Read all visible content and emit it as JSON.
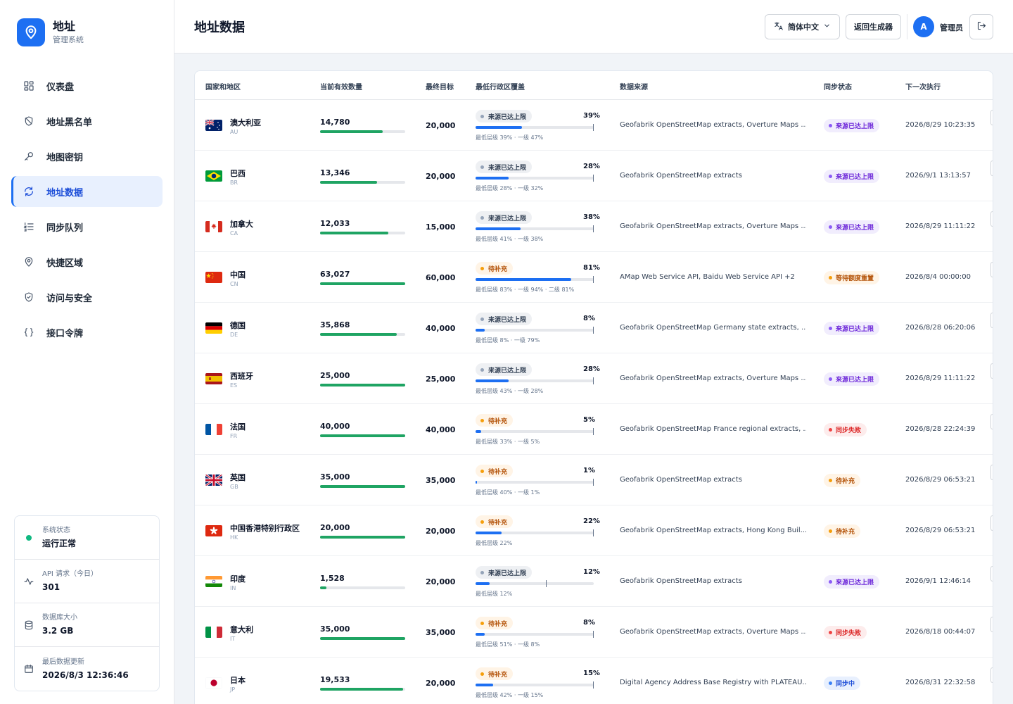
{
  "brand": {
    "title": "地址",
    "subtitle": "管理系统"
  },
  "nav": [
    {
      "id": "dashboard",
      "label": "仪表盘",
      "icon": "dashboard-grid-icon"
    },
    {
      "id": "blacklist",
      "label": "地址黑名单",
      "icon": "shield-off-icon"
    },
    {
      "id": "map-key",
      "label": "地图密钥",
      "icon": "key-icon"
    },
    {
      "id": "address-data",
      "label": "地址数据",
      "icon": "refresh-icon",
      "active": true
    },
    {
      "id": "sync-queue",
      "label": "同步队列",
      "icon": "list-order-icon"
    },
    {
      "id": "quick-region",
      "label": "快捷区域",
      "icon": "map-pin-icon"
    },
    {
      "id": "access-security",
      "label": "访问与安全",
      "icon": "shield-check-icon"
    },
    {
      "id": "api-token",
      "label": "接口令牌",
      "icon": "braces-icon"
    }
  ],
  "status": {
    "system": {
      "label": "系统状态",
      "value": "运行正常"
    },
    "api": {
      "label": "API 请求（今日）",
      "value": "301"
    },
    "db": {
      "label": "数据库大小",
      "value": "3.2 GB"
    },
    "updated": {
      "label": "最后数据更新",
      "value": "2026/8/3 12:36:46"
    }
  },
  "header": {
    "title": "地址数据",
    "language": "简体中文",
    "back": "返回生成器",
    "avatar": "A",
    "user": "管理员"
  },
  "table": {
    "columns": {
      "country": "国家和地区",
      "count": "当前有效数量",
      "target": "最终目标",
      "coverage": "最低行政区覆盖",
      "source": "数据来源",
      "sync": "同步状态",
      "next": "下一次执行"
    },
    "rows": [
      {
        "name": "澳大利亚",
        "code": "AU",
        "flag": "au",
        "count": "14,780",
        "count_ratio": 0.739,
        "target": "20,000",
        "cov_status": "来源已达上限",
        "cov_kind": "gray",
        "cov_pct": "39%",
        "cov_value": 0.39,
        "cov_mark": 1.0,
        "cov_detail": "最低层级 39% · 一级 47%",
        "source": "Geofabrik OpenStreetMap extracts, Overture Maps ...",
        "sync": "来源已达上限",
        "sync_kind": "purple",
        "next": "2026/8/29 10:23:35"
      },
      {
        "name": "巴西",
        "code": "BR",
        "flag": "br",
        "count": "13,346",
        "count_ratio": 0.667,
        "target": "20,000",
        "cov_status": "来源已达上限",
        "cov_kind": "gray",
        "cov_pct": "28%",
        "cov_value": 0.28,
        "cov_mark": 1.0,
        "cov_detail": "最低层级 28% · 一级 32%",
        "source": "Geofabrik OpenStreetMap extracts",
        "sync": "来源已达上限",
        "sync_kind": "purple",
        "next": "2026/9/1 13:13:57"
      },
      {
        "name": "加拿大",
        "code": "CA",
        "flag": "ca",
        "count": "12,033",
        "count_ratio": 0.802,
        "target": "15,000",
        "cov_status": "来源已达上限",
        "cov_kind": "gray",
        "cov_pct": "38%",
        "cov_value": 0.38,
        "cov_mark": 1.0,
        "cov_detail": "最低层级 41% · 一级 38%",
        "source": "Geofabrik OpenStreetMap extracts, Overture Maps ...",
        "sync": "来源已达上限",
        "sync_kind": "purple",
        "next": "2026/8/29 11:11:22"
      },
      {
        "name": "中国",
        "code": "CN",
        "flag": "cn",
        "count": "63,027",
        "count_ratio": 1.0,
        "target": "60,000",
        "cov_status": "待补充",
        "cov_kind": "orange",
        "cov_pct": "81%",
        "cov_value": 0.81,
        "cov_mark": 1.0,
        "cov_detail": "最低层级 83% · 一级 94% · 二级 81%",
        "source": "AMap Web Service API, Baidu Web Service API +2",
        "sync": "等待额度重置",
        "sync_kind": "orange",
        "next": "2026/8/4 00:00:00"
      },
      {
        "name": "德国",
        "code": "DE",
        "flag": "de",
        "count": "35,868",
        "count_ratio": 0.897,
        "target": "40,000",
        "cov_status": "来源已达上限",
        "cov_kind": "gray",
        "cov_pct": "8%",
        "cov_value": 0.08,
        "cov_mark": 1.0,
        "cov_detail": "最低层级 8% · 一级 79%",
        "source": "Geofabrik OpenStreetMap Germany state extracts, ...",
        "sync": "来源已达上限",
        "sync_kind": "purple",
        "next": "2026/8/28 06:20:06"
      },
      {
        "name": "西班牙",
        "code": "ES",
        "flag": "es",
        "count": "25,000",
        "count_ratio": 1.0,
        "target": "25,000",
        "cov_status": "来源已达上限",
        "cov_kind": "gray",
        "cov_pct": "28%",
        "cov_value": 0.28,
        "cov_mark": 1.0,
        "cov_detail": "最低层级 43% · 一级 28%",
        "source": "Geofabrik OpenStreetMap extracts, Overture Maps ...",
        "sync": "来源已达上限",
        "sync_kind": "purple",
        "next": "2026/8/29 11:11:22"
      },
      {
        "name": "法国",
        "code": "FR",
        "flag": "fr",
        "count": "40,000",
        "count_ratio": 1.0,
        "target": "40,000",
        "cov_status": "待补充",
        "cov_kind": "orange",
        "cov_pct": "5%",
        "cov_value": 0.05,
        "cov_mark": 1.0,
        "cov_detail": "最低层级 33% · 一级 5%",
        "source": "Geofabrik OpenStreetMap France regional extracts, ...",
        "sync": "同步失败",
        "sync_kind": "red",
        "next": "2026/8/28 22:24:39"
      },
      {
        "name": "英国",
        "code": "GB",
        "flag": "gb",
        "count": "35,000",
        "count_ratio": 1.0,
        "target": "35,000",
        "cov_status": "待补充",
        "cov_kind": "orange",
        "cov_pct": "1%",
        "cov_value": 0.01,
        "cov_mark": 1.0,
        "cov_detail": "最低层级 40% · 一级 1%",
        "source": "Geofabrik OpenStreetMap extracts",
        "sync": "待补充",
        "sync_kind": "orange",
        "next": "2026/8/29 06:53:21"
      },
      {
        "name": "中国香港特别行政区",
        "code": "HK",
        "flag": "hk",
        "count": "20,000",
        "count_ratio": 1.0,
        "target": "20,000",
        "cov_status": "待补充",
        "cov_kind": "orange",
        "cov_pct": "22%",
        "cov_value": 0.22,
        "cov_mark": 1.0,
        "cov_detail": "最低层级 22%",
        "source": "Geofabrik OpenStreetMap extracts, Hong Kong Buil...",
        "sync": "待补充",
        "sync_kind": "orange",
        "next": "2026/8/29 06:53:21"
      },
      {
        "name": "印度",
        "code": "IN",
        "flag": "in",
        "count": "1,528",
        "count_ratio": 0.076,
        "target": "20,000",
        "cov_status": "来源已达上限",
        "cov_kind": "gray",
        "cov_pct": "12%",
        "cov_value": 0.12,
        "cov_mark": 0.6,
        "cov_detail": "最低层级 12%",
        "source": "Geofabrik OpenStreetMap extracts",
        "sync": "来源已达上限",
        "sync_kind": "purple",
        "next": "2026/9/1 12:46:14"
      },
      {
        "name": "意大利",
        "code": "IT",
        "flag": "it",
        "count": "35,000",
        "count_ratio": 1.0,
        "target": "35,000",
        "cov_status": "待补充",
        "cov_kind": "orange",
        "cov_pct": "8%",
        "cov_value": 0.08,
        "cov_mark": 1.0,
        "cov_detail": "最低层级 51% · 一级 8%",
        "source": "Geofabrik OpenStreetMap extracts, Overture Maps ...",
        "sync": "同步失败",
        "sync_kind": "red",
        "next": "2026/8/18 00:44:07"
      },
      {
        "name": "日本",
        "code": "JP",
        "flag": "jp",
        "count": "19,533",
        "count_ratio": 0.977,
        "target": "20,000",
        "cov_status": "待补充",
        "cov_kind": "orange",
        "cov_pct": "15%",
        "cov_value": 0.15,
        "cov_mark": 1.0,
        "cov_detail": "最低层级 42% · 一级 15%",
        "source": "Digital Agency Address Base Registry with PLATEAU...",
        "sync": "同步中",
        "sync_kind": "blue",
        "next": "2026/8/31 22:32:58"
      }
    ]
  },
  "colors": {
    "accent": "#1d6ff2",
    "progress_green": "#1fa463",
    "coverage_blue": "#1d6ff2"
  }
}
